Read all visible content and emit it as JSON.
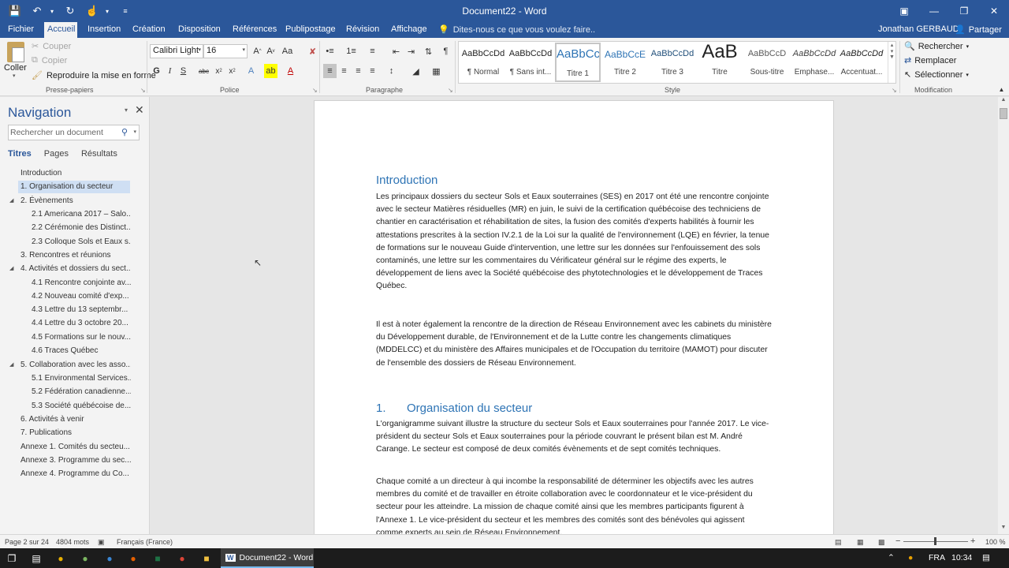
{
  "window": {
    "title": "Document22 - Word",
    "accent_color": "#2b579a"
  },
  "quick_access": {
    "save_icon": "save-icon",
    "undo_icon": "undo-icon",
    "redo_icon": "redo-icon",
    "touch_icon": "touch-mode-icon"
  },
  "ribbon_tabs": [
    "Fichier",
    "Accueil",
    "Insertion",
    "Création",
    "Disposition",
    "Références",
    "Publipostage",
    "Révision",
    "Affichage"
  ],
  "active_tab": "Accueil",
  "tell_me": "Dites-nous ce que vous voulez faire..",
  "user_name": "Jonathan GERBAUD",
  "share_label": "Partager",
  "clipboard": {
    "paste": "Coller",
    "cut": "Couper",
    "copy": "Copier",
    "format_painter": "Reproduire la mise en forme",
    "group_label": "Presse-papiers"
  },
  "font": {
    "name": "Calibri Light",
    "size": "16",
    "group_label": "Police"
  },
  "paragraph": {
    "group_label": "Paragraphe"
  },
  "styles": {
    "group_label": "Style",
    "items": [
      {
        "preview": "AaBbCcDd",
        "name": "¶ Normal"
      },
      {
        "preview": "AaBbCcDd",
        "name": "¶ Sans int..."
      },
      {
        "preview": "AaBbCc",
        "name": "Titre 1"
      },
      {
        "preview": "AaBbCcE",
        "name": "Titre 2"
      },
      {
        "preview": "AaBbCcDd",
        "name": "Titre 3"
      },
      {
        "preview": "AaB",
        "name": "Titre"
      },
      {
        "preview": "AaBbCcD",
        "name": "Sous-titre"
      },
      {
        "preview": "AaBbCcDd",
        "name": "Emphase..."
      },
      {
        "preview": "AaBbCcDd",
        "name": "Accentuat..."
      }
    ]
  },
  "editing": {
    "find": "Rechercher",
    "replace": "Remplacer",
    "select": "Sélectionner",
    "group_label": "Modification"
  },
  "navigation": {
    "title": "Navigation",
    "search_placeholder": "Rechercher un document",
    "tabs": [
      "Titres",
      "Pages",
      "Résultats"
    ],
    "items": [
      {
        "label": "Introduction"
      },
      {
        "label": "1. Organisation du secteur"
      },
      {
        "label": "2. Évènements"
      },
      {
        "label": "2.1 Americana 2017 – Salo..."
      },
      {
        "label": "2.2 Cérémonie des Distinct..."
      },
      {
        "label": "2.3 Colloque Sols et Eaux s..."
      },
      {
        "label": "3. Rencontres et réunions"
      },
      {
        "label": "4. Activités et dossiers du sect..."
      },
      {
        "label": "4.1 Rencontre conjointe av..."
      },
      {
        "label": "4.2 Nouveau comité d'exp..."
      },
      {
        "label": "4.3 Lettre du 13 septembr..."
      },
      {
        "label": "4.4 Lettre du 3 octobre 20..."
      },
      {
        "label": "4.5 Formations sur le nouv..."
      },
      {
        "label": "4.6 Traces Québec"
      },
      {
        "label": "5. Collaboration avec les asso..."
      },
      {
        "label": "5.1 Environmental Services..."
      },
      {
        "label": "5.2 Fédération canadienne..."
      },
      {
        "label": "5.3 Société québécoise de..."
      },
      {
        "label": "6. Activités à venir"
      },
      {
        "label": "7. Publications"
      },
      {
        "label": "Annexe 1.  Comités du secteu..."
      },
      {
        "label": "Annexe 3.  Programme du sec..."
      },
      {
        "label": "Annexe 4.  Programme du Co..."
      }
    ]
  },
  "document": {
    "heading_intro": "Introduction",
    "para1": "Les principaux dossiers du secteur Sols et Eaux souterraines (SES) en 2017 ont été une rencontre conjointe avec le secteur Matières résiduelles (MR) en juin, le suivi de la certification québécoise des techniciens de chantier en caractérisation et réhabilitation de sites, la fusion des comités d'experts habilités à fournir les attestations prescrites à la section IV.2.1 de la Loi sur la qualité de l'environnement (LQE) en février, la tenue de formations sur le nouveau Guide d'intervention, une lettre sur les données sur l'enfouissement des sols contaminés, une lettre sur les commentaires du Vérificateur général sur le régime des experts, le développement de liens avec la Société québécoise des phytotechnologies et le développement de Traces Québec.",
    "para2": "Il est à noter également la rencontre de la direction de Réseau Environnement avec les cabinets du ministère du Développement durable, de l'Environnement et de la Lutte contre les changements climatiques (MDDELCC) et du ministère des Affaires municipales et de l'Occupation du territoire (MAMOT) pour discuter de l'ensemble des dossiers de Réseau Environnement.",
    "heading1_num": "1.",
    "heading1_text": "Organisation du secteur",
    "para3": "L'organigramme suivant illustre la structure du secteur Sols et Eaux souterraines pour l'année 2017. Le vice-président du secteur Sols et Eaux souterraines pour la période couvrant le présent bilan est M. André Carange. Le secteur est composé de deux comités évènements et de sept comités techniques.",
    "para4": "Chaque comité a un directeur à qui incombe la responsabilité de déterminer les objectifs avec les autres membres du comité et de travailler en étroite collaboration avec le coordonnateur et le vice-président du secteur pour les atteindre. La mission de chaque comité ainsi que les membres participants figurent à l'Annexe 1. Le vice-président du secteur et les membres des comités sont des bénévoles qui agissent comme experts au sein de Réseau Environnement."
  },
  "status": {
    "page": "Page 2 sur 24",
    "words": "4804 mots",
    "language": "Français (France)",
    "zoom": "100 %"
  },
  "taskbar": {
    "app_label": "Document22 - Word",
    "lang": "FRA",
    "time": "10:34"
  }
}
